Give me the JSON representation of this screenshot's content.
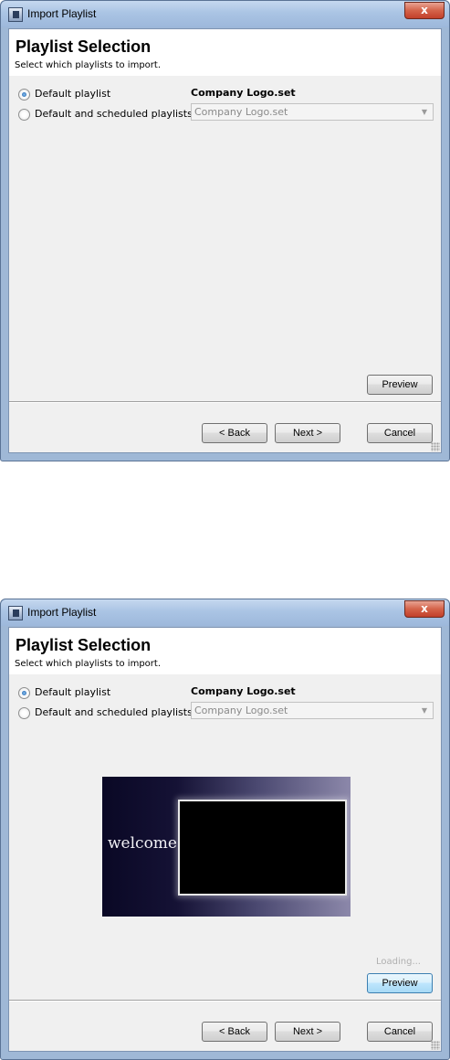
{
  "dialogs": [
    {
      "state": "initial",
      "window_title": "Import Playlist",
      "close_glyph": "x",
      "page_title": "Playlist Selection",
      "page_subtitle": "Select which playlists to import.",
      "options": [
        {
          "label": "Default playlist",
          "checked": true
        },
        {
          "label": "Default and scheduled playlists",
          "checked": false
        }
      ],
      "set_label": "Company Logo.set",
      "combo_value": "Company Logo.set",
      "buttons": {
        "preview": "Preview",
        "back": "< Back",
        "next": "Next >",
        "cancel": "Cancel"
      }
    },
    {
      "state": "preview-loaded",
      "window_title": "Import Playlist",
      "close_glyph": "x",
      "page_title": "Playlist Selection",
      "page_subtitle": "Select which playlists to import.",
      "options": [
        {
          "label": "Default playlist",
          "checked": true
        },
        {
          "label": "Default and scheduled playlists",
          "checked": false
        }
      ],
      "set_label": "Company Logo.set",
      "combo_value": "Company Logo.set",
      "preview_text": "welcome",
      "loading_text": "Loading...",
      "buttons": {
        "preview": "Preview",
        "back": "< Back",
        "next": "Next >",
        "cancel": "Cancel"
      }
    }
  ],
  "colors": {
    "titlebar": "#aac4e4",
    "close_button": "#c2402a",
    "client_background": "#f0f0f0",
    "header_background": "#ffffff",
    "preview_background": "#151235",
    "focused_button": "#bee6fd"
  }
}
